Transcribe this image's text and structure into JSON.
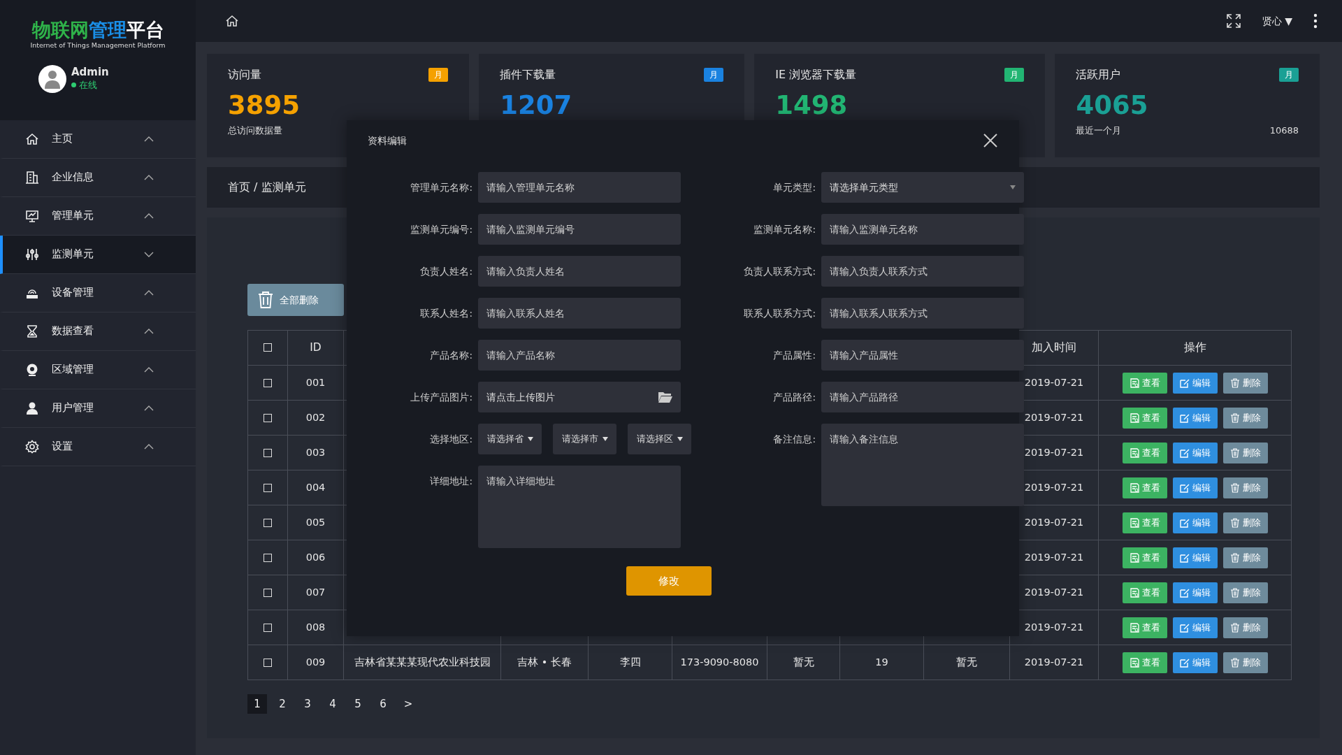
{
  "brand": {
    "title_parts": [
      {
        "text": "物联网",
        "color": "#2fb34a"
      },
      {
        "text": "管理",
        "color": "#1a8fe8"
      },
      {
        "text": "平台",
        "color": "#ffffff"
      }
    ],
    "subtitle": "Internet of Things Management Platform"
  },
  "user": {
    "name": "Admin",
    "status": "在线"
  },
  "sidebar": {
    "items": [
      {
        "label": "主页",
        "selected": false,
        "expanded": false
      },
      {
        "label": "企业信息",
        "selected": false,
        "expanded": false
      },
      {
        "label": "管理单元",
        "selected": false,
        "expanded": false
      },
      {
        "label": "监测单元",
        "selected": true,
        "expanded": true
      },
      {
        "label": "设备管理",
        "selected": false,
        "expanded": false
      },
      {
        "label": "数据查看",
        "selected": false,
        "expanded": false
      },
      {
        "label": "区域管理",
        "selected": false,
        "expanded": false
      },
      {
        "label": "用户管理",
        "selected": false,
        "expanded": false
      },
      {
        "label": "设置",
        "selected": false,
        "expanded": false
      }
    ]
  },
  "topbar": {
    "user_menu": "贤心 ▼"
  },
  "stats": [
    {
      "title": "访问量",
      "badge": "月",
      "color": "#f5a100",
      "value": "3895",
      "caption": "总访问数据量"
    },
    {
      "title": "插件下载量",
      "badge": "月",
      "color": "#1a82e0",
      "value": "1207"
    },
    {
      "title": "IE 浏览器下载量",
      "badge": "月",
      "color": "#22b573",
      "value": "1498"
    },
    {
      "title": "活跃用户",
      "badge": "月",
      "color": "#1aa095",
      "value": "4065",
      "caption": "最近一个月",
      "total": "10688"
    }
  ],
  "breadcrumb": "首页 / 监测单元",
  "toolbar": {
    "delete_all": "全部删除"
  },
  "table": {
    "header_checked": false,
    "columns": [
      "ID",
      "加入时间",
      "操作"
    ],
    "rows": [
      {
        "checked": false,
        "id": "001",
        "date": "2019-07-21",
        "actions": [
          "查看",
          "编辑",
          "删除"
        ]
      },
      {
        "checked": false,
        "id": "002",
        "date": "2019-07-21",
        "actions": [
          "查看",
          "编辑",
          "删除"
        ]
      },
      {
        "checked": false,
        "id": "003",
        "date": "2019-07-21",
        "actions": [
          "查看",
          "编辑",
          "删除"
        ]
      },
      {
        "checked": false,
        "id": "004",
        "date": "2019-07-21",
        "actions": [
          "查看",
          "编辑",
          "删除"
        ]
      },
      {
        "checked": false,
        "id": "005",
        "date": "2019-07-21",
        "actions": [
          "查看",
          "编辑",
          "删除"
        ]
      },
      {
        "checked": false,
        "id": "006",
        "date": "2019-07-21",
        "actions": [
          "查看",
          "编辑",
          "删除"
        ]
      },
      {
        "checked": false,
        "id": "007",
        "date": "2019-07-21",
        "actions": [
          "查看",
          "编辑",
          "删除"
        ]
      },
      {
        "checked": false,
        "id": "008",
        "date": "2019-07-21",
        "actions": [
          "查看",
          "编辑",
          "删除"
        ]
      },
      {
        "checked": false,
        "id": "009",
        "cells": [
          "吉林省某某某现代农业科技园",
          "吉林 • 长春",
          "李四",
          "173-9090-8080",
          "暂无",
          "19",
          "暂无"
        ],
        "date": "2019-07-21",
        "actions": [
          "查看",
          "编辑",
          "删除"
        ]
      }
    ]
  },
  "pagination": [
    {
      "label": "1",
      "selected": true
    },
    {
      "label": "2",
      "selected": false
    },
    {
      "label": "3",
      "selected": false
    },
    {
      "label": "4",
      "selected": false
    },
    {
      "label": "5",
      "selected": false
    },
    {
      "label": "6",
      "selected": false
    },
    {
      "label": ">",
      "selected": false
    }
  ],
  "modal": {
    "title": "资料编辑",
    "left": [
      {
        "kind": "input",
        "label": "管理单元名称:",
        "placeholder": "请输入管理单元名称"
      },
      {
        "kind": "input",
        "label": "监测单元编号:",
        "placeholder": "请输入监测单元编号"
      },
      {
        "kind": "input",
        "label": "负责人姓名:",
        "placeholder": "请输入负责人姓名"
      },
      {
        "kind": "input",
        "label": "联系人姓名:",
        "placeholder": "请输入联系人姓名"
      },
      {
        "kind": "input",
        "label": "产品名称:",
        "placeholder": "请输入产品名称"
      },
      {
        "kind": "upload",
        "label": "上传产品图片:",
        "placeholder": "请点击上传图片"
      },
      {
        "kind": "region",
        "label": "选择地区:",
        "options": [
          "请选择省",
          "请选择市",
          "请选择区"
        ]
      },
      {
        "kind": "textarea",
        "label": "详细地址:",
        "placeholder": "请输入详细地址"
      }
    ],
    "right": [
      {
        "kind": "select",
        "label": "单元类型:",
        "placeholder": "请选择单元类型"
      },
      {
        "kind": "input",
        "label": "监测单元名称:",
        "placeholder": "请输入监测单元名称"
      },
      {
        "kind": "input",
        "label": "负责人联系方式:",
        "placeholder": "请输入负责人联系方式"
      },
      {
        "kind": "input",
        "label": "联系人联系方式:",
        "placeholder": "请输入联系人联系方式"
      },
      {
        "kind": "input",
        "label": "产品属性:",
        "placeholder": "请输入产品属性"
      },
      {
        "kind": "input",
        "label": "产品路径:",
        "placeholder": "请输入产品路径"
      },
      {
        "kind": "textarea",
        "label": "备注信息:",
        "placeholder": "请输入备注信息"
      }
    ],
    "submit": "修改"
  }
}
